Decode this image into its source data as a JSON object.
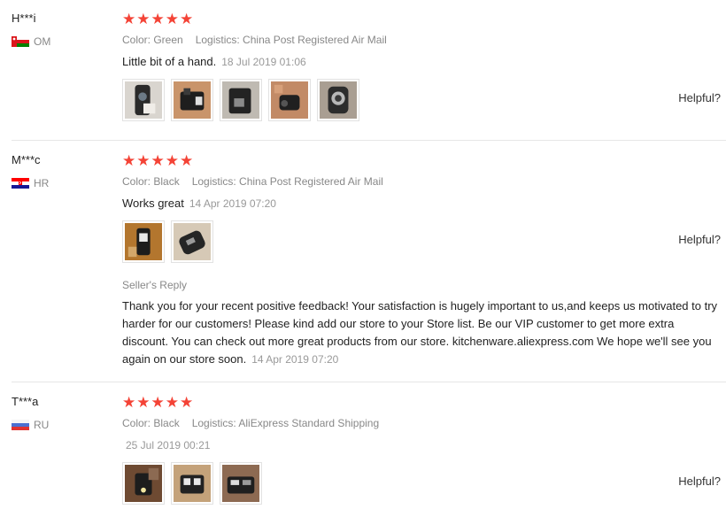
{
  "reviews": [
    {
      "user": "H***i",
      "country": "OM",
      "stars": "★★★★★",
      "color": "Color: Green",
      "logistics": "Logistics: China Post Registered Air Mail",
      "text": "Little bit of a hand.",
      "date": "18 Jul 2019 01:06",
      "helpful": "Helpful?"
    },
    {
      "user": "M***c",
      "country": "HR",
      "stars": "★★★★★",
      "color": "Color: Black",
      "logistics": "Logistics: China Post Registered Air Mail",
      "text": "Works great",
      "date": "14 Apr 2019 07:20",
      "helpful": "Helpful?",
      "seller_reply_label": "Seller's Reply",
      "seller_reply": "Thank you for your recent positive feedback! Your satisfaction is hugely important to us,and keeps us motivated to try harder for our customers! Please kind add our store to your Store list. Be our VIP customer to get more extra discount. You can check out more great products from our store. kitchenware.aliexpress.com We hope we'll see you again on our store soon.",
      "seller_reply_date": "14 Apr 2019 07:20"
    },
    {
      "user": "T***a",
      "country": "RU",
      "stars": "★★★★★",
      "color": "Color: Black",
      "logistics": "Logistics: AliExpress Standard Shipping",
      "date": "25 Jul 2019 00:21",
      "helpful": "Helpful?"
    }
  ],
  "rating": 5,
  "colors": {
    "star": "#f44336",
    "muted": "#888888"
  }
}
